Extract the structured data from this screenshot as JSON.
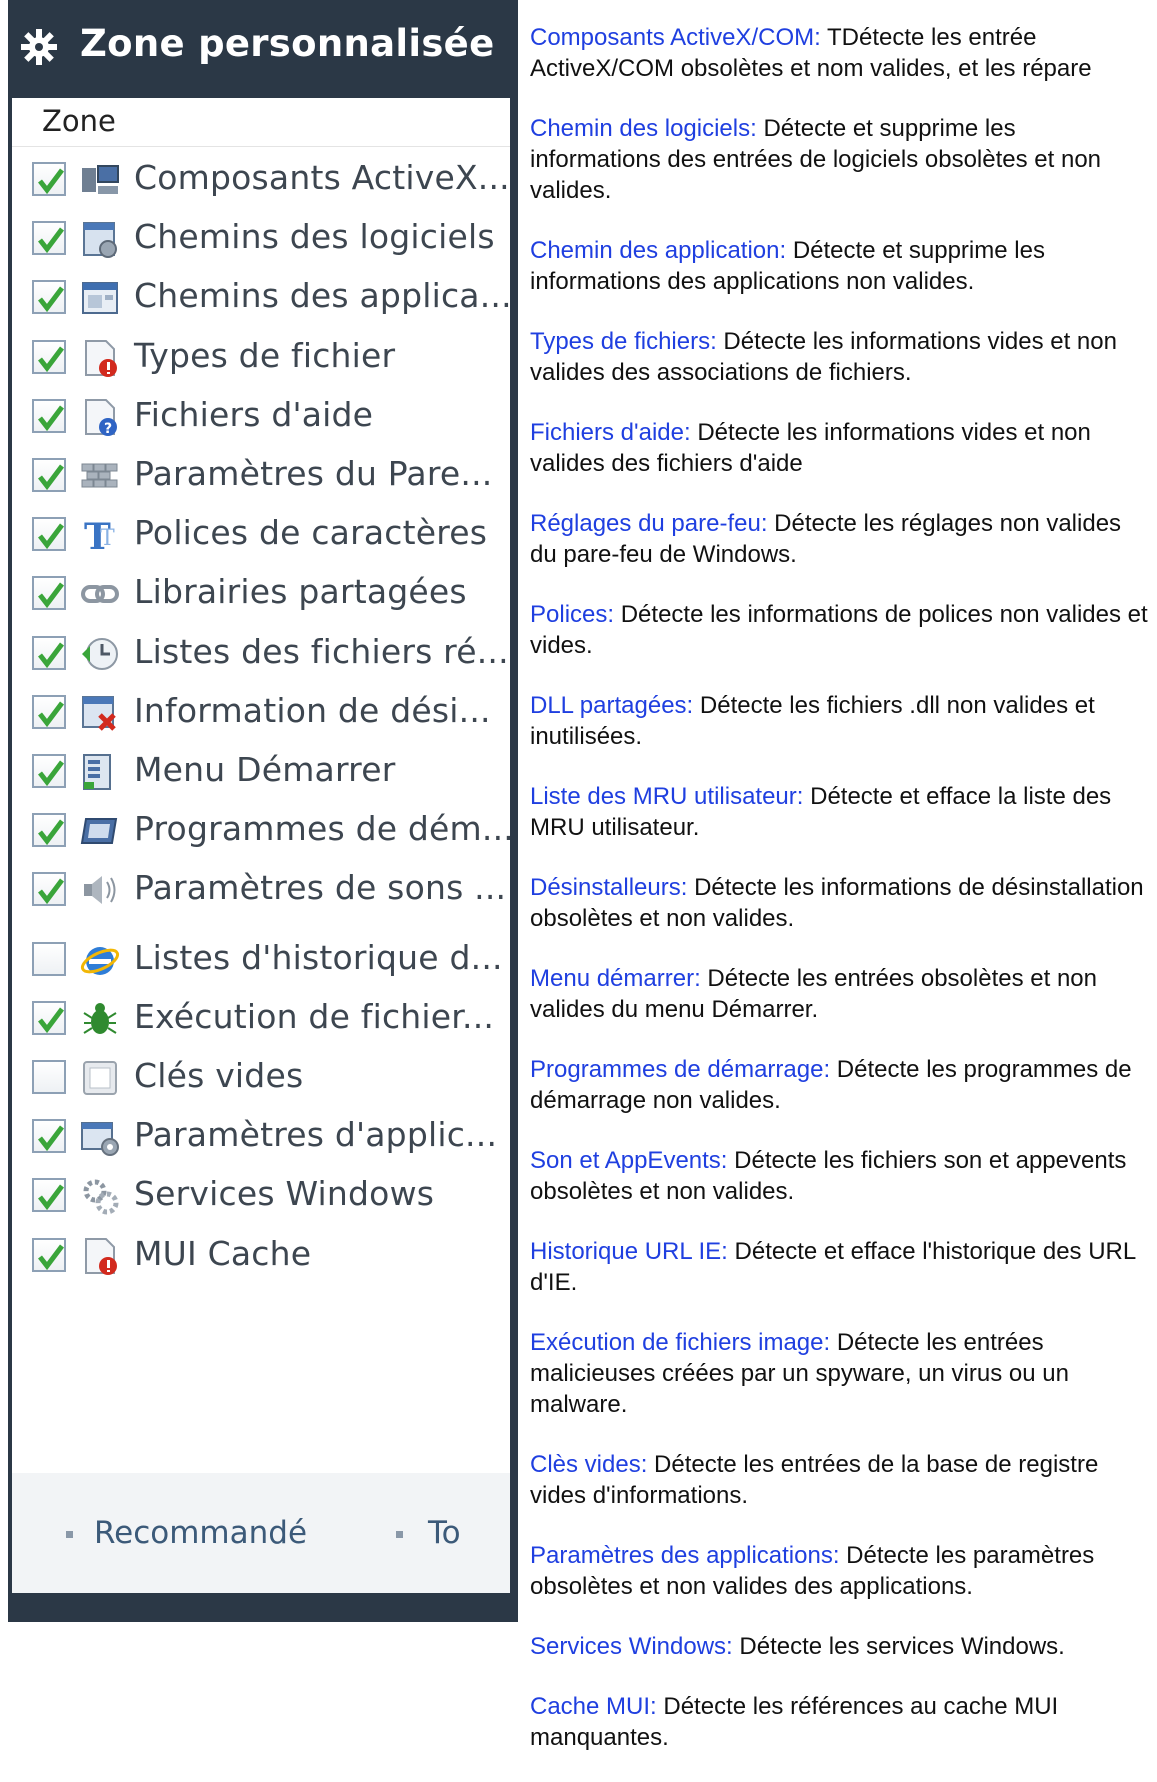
{
  "panel": {
    "title": "Zone personnalisée",
    "column_header": "Zone",
    "items": [
      {
        "label": "Composants ActiveX...",
        "checked": true,
        "icon": "computer-icon"
      },
      {
        "label": "Chemins des logiciels",
        "checked": true,
        "icon": "software-path-icon"
      },
      {
        "label": "Chemins des applica...",
        "checked": true,
        "icon": "application-window-icon"
      },
      {
        "label": "Types de fichier",
        "checked": true,
        "icon": "file-type-warning-icon"
      },
      {
        "label": "Fichiers d'aide",
        "checked": true,
        "icon": "help-file-icon"
      },
      {
        "label": "Paramètres du Pare...",
        "checked": true,
        "icon": "firewall-brick-icon"
      },
      {
        "label": "Polices de caractères",
        "checked": true,
        "icon": "font-icon"
      },
      {
        "label": "Librairies partagées",
        "checked": true,
        "icon": "chain-link-icon"
      },
      {
        "label": "Listes des fichiers ré...",
        "checked": true,
        "icon": "recent-clock-icon"
      },
      {
        "label": "Information de dési...",
        "checked": true,
        "icon": "uninstall-icon"
      },
      {
        "label": "Menu Démarrer",
        "checked": true,
        "icon": "start-menu-icon"
      },
      {
        "label": "Programmes de dém...",
        "checked": true,
        "icon": "startup-program-icon"
      },
      {
        "label": "Paramètres de sons ...",
        "checked": true,
        "icon": "speaker-icon"
      },
      {
        "label": "Listes d'historique d...",
        "checked": false,
        "icon": "internet-explorer-icon"
      },
      {
        "label": "Exécution de fichier...",
        "checked": true,
        "icon": "bug-icon"
      },
      {
        "label": "Clés vides",
        "checked": false,
        "icon": "empty-key-icon"
      },
      {
        "label": "Paramètres d'applic...",
        "checked": true,
        "icon": "app-settings-icon"
      },
      {
        "label": "Services Windows",
        "checked": true,
        "icon": "services-gear-icon"
      },
      {
        "label": "MUI Cache",
        "checked": true,
        "icon": "mui-cache-icon"
      }
    ],
    "footer": {
      "option_1": "Recommandé",
      "option_2": "To"
    }
  },
  "descriptions": [
    {
      "term": "Composants ActiveX/COM:",
      "text": " TDétecte les entrée ActiveX/COM obsolètes et nom valides, et les répare"
    },
    {
      "term": "Chemin des logiciels:",
      "text": " Détecte et supprime les informations des entrées de logiciels obsolètes et non valides."
    },
    {
      "term": "Chemin des application:",
      "text": " Détecte et supprime les informations des applications non valides."
    },
    {
      "term": "Types de fichiers:",
      "text": " Détecte les informations vides et non valides des  associations de fichiers."
    },
    {
      "term": "Fichiers d'aide:",
      "text": " Détecte les informations vides et non valides des fichiers d'aide"
    },
    {
      "term": "Réglages du pare-feu:",
      "text": " Détecte les réglages non valides du pare-feu de Windows."
    },
    {
      "term": "Polices:",
      "text": " Détecte les informations de polices non valides et vides."
    },
    {
      "term": "DLL partagées:",
      "text": " Détecte les fichiers .dll non valides et inutilisées."
    },
    {
      "term": "Liste des MRU utilisateur:",
      "text": " Détecte et efface la liste des MRU utilisateur."
    },
    {
      "term": "Désinstalleurs:",
      "text": " Détecte les informations de désinstallation obsolètes et non valides."
    },
    {
      "term": "Menu démarrer:",
      "text": " Détecte les entrées obsolètes et non valides du menu Démarrer."
    },
    {
      "term": "Programmes de démarrage:",
      "text": " Détecte les programmes de démarrage non valides."
    },
    {
      "term": "Son et AppEvents:",
      "text": " Détecte les fichiers son et appevents obsolètes et non valides."
    },
    {
      "term": "Historique URL IE:",
      "text": " Détecte et efface l'historique des URL d'IE."
    },
    {
      "term": "Exécution de fichiers image:",
      "text": " Détecte les entrées malicieuses créées par un  spyware, un virus ou un malware."
    },
    {
      "term": "Clès vides:",
      "text": " Détecte les entrées de la base de registre vides d'informations."
    },
    {
      "term": "Paramètres des applications:",
      "text": " Détecte les paramètres obsolètes et non valides des applications."
    },
    {
      "term": "Services Windows:",
      "text": " Détecte les services Windows."
    },
    {
      "term": "Cache MUI:",
      "text": " Détecte les références au cache MUI manquantes."
    }
  ],
  "colors": {
    "header_bg": "#2b3846",
    "term_blue": "#1f3fe0",
    "check_green": "#3aa53a",
    "link_text": "#3c5a79"
  }
}
